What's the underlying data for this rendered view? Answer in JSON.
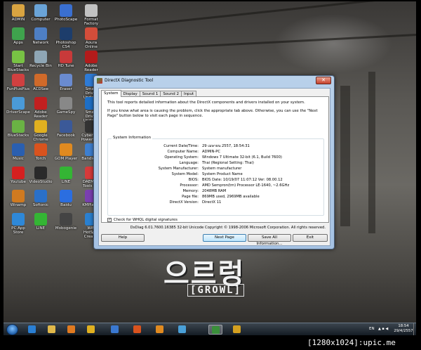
{
  "desktop": {
    "icons": [
      {
        "label": "ADMIN",
        "icon": "user-folder-icon",
        "color": "#d9a441"
      },
      {
        "label": "Computer",
        "icon": "computer-icon",
        "color": "#6aa4d8"
      },
      {
        "label": "PhotoScape",
        "icon": "photoscape-icon",
        "color": "#3a6fd0"
      },
      {
        "label": "Format Factory",
        "icon": "format-factory-icon",
        "color": "#c2c2c2"
      },
      {
        "label": "Apps",
        "icon": "apps-icon",
        "color": "#3fa34d"
      },
      {
        "label": "Network",
        "icon": "network-icon",
        "color": "#4e7fc4"
      },
      {
        "label": "Photoshop CS4",
        "icon": "photoshop-icon",
        "color": "#1d3d6b"
      },
      {
        "label": "Aoura Online",
        "icon": "game-icon",
        "color": "#d34d3a"
      },
      {
        "label": "Start BlueStacks",
        "icon": "bluestacks-icon",
        "color": "#78c244"
      },
      {
        "label": "Recycle Bin",
        "icon": "recycle-bin-icon",
        "color": "#8fa6b5"
      },
      {
        "label": "HD Tune",
        "icon": "hd-tune-icon",
        "color": "#c83a3a"
      },
      {
        "label": "Adobe Reader",
        "icon": "adobe-reader-icon",
        "color": "#b31b1b"
      },
      {
        "label": "FunPlusPlus",
        "icon": "game-icon",
        "color": "#d04040"
      },
      {
        "label": "ACDSee",
        "icon": "acdsee-icon",
        "color": "#d06a2a"
      },
      {
        "label": "Eraser",
        "icon": "app-icon",
        "color": "#6a8bd0"
      },
      {
        "label": "Smart Driver Updater",
        "icon": "driver-icon",
        "color": "#2e7bd6"
      },
      {
        "label": "DriverScape",
        "icon": "driver-icon",
        "color": "#4a9ad8"
      },
      {
        "label": "Adobe Reader",
        "icon": "adobe-reader-icon",
        "color": "#c12020"
      },
      {
        "label": "GameSpy",
        "icon": "game-icon",
        "color": "#888"
      },
      {
        "label": "Smart Driver Updater",
        "icon": "driver-icon",
        "color": "#1e6fc6"
      },
      {
        "label": "BlueStacks",
        "icon": "bluestacks-icon",
        "color": "#6ab344"
      },
      {
        "label": "Google Chrome",
        "icon": "chrome-icon",
        "color": "#e0b020"
      },
      {
        "label": "Facebook",
        "icon": "facebook-icon",
        "color": "#3b5998"
      },
      {
        "label": "CyberLink PowerDVD",
        "icon": "dvd-icon",
        "color": "#333"
      },
      {
        "label": "Music",
        "icon": "music-icon",
        "color": "#2a5fb0"
      },
      {
        "label": "Torch",
        "icon": "torch-icon",
        "color": "#d9531e"
      },
      {
        "label": "GOM Player",
        "icon": "gom-player-icon",
        "color": "#e08a20"
      },
      {
        "label": "Bandicam",
        "icon": "bandicam-icon",
        "color": "#3d7fd0"
      },
      {
        "label": "Youtube",
        "icon": "youtube-icon",
        "color": "#d52020"
      },
      {
        "label": "VideoStudio",
        "icon": "video-icon",
        "color": "#2a2a2a"
      },
      {
        "label": "LINE",
        "icon": "line-icon",
        "color": "#34b534"
      },
      {
        "label": "DAEMON Tools Pro",
        "icon": "daemon-tools-icon",
        "color": "#d63a3a"
      },
      {
        "label": "Winamp",
        "icon": "winamp-icon",
        "color": "#d07a20"
      },
      {
        "label": "Softonic",
        "icon": "softonic-icon",
        "color": "#2a70c8"
      },
      {
        "label": "Baidu",
        "icon": "baidu-icon",
        "color": "#2b6ee0"
      },
      {
        "label": "KMPlayer",
        "icon": "kmplayer-icon",
        "color": "#7a3fb0"
      },
      {
        "label": "PC App Store",
        "icon": "app-store-icon",
        "color": "#2e88d8"
      },
      {
        "label": "LINE",
        "icon": "line-icon",
        "color": "#34b534"
      },
      {
        "label": "Mobogenie",
        "icon": "mobogenie-icon",
        "color": "#444"
      },
      {
        "label": "WiFi HotSpot Creator",
        "icon": "wifi-icon",
        "color": "#2a80d0"
      }
    ],
    "graffiti_main": "으르렁",
    "graffiti_sub": "[GROWL]"
  },
  "dialog": {
    "title": "DirectX Diagnostic Tool",
    "close_glyph": "✕",
    "tabs": [
      {
        "label": "System",
        "active": true
      },
      {
        "label": "Display",
        "active": false
      },
      {
        "label": "Sound 1",
        "active": false
      },
      {
        "label": "Sound 2",
        "active": false
      },
      {
        "label": "Input",
        "active": false
      }
    ],
    "intro": "This tool reports detailed information about the DirectX components and drivers installed on your system.",
    "help_text": "If you know what area is causing the problem, click the appropriate tab above.  Otherwise, you can use the \"Next Page\" button below to visit each page in sequence.",
    "group_label": "System Information",
    "rows": [
      {
        "k": "Current Date/Time:",
        "v": "29 เมษายน 2557, 18:54:31"
      },
      {
        "k": "Computer Name:",
        "v": "ADMIN-PC"
      },
      {
        "k": "Operating System:",
        "v": "Windows 7 Ultimate 32-bit (6.1, Build 7600)"
      },
      {
        "k": "Language:",
        "v": "Thai (Regional Setting: Thai)"
      },
      {
        "k": "System Manufacturer:",
        "v": "System manufacturer"
      },
      {
        "k": "System Model:",
        "v": "System Product Name"
      },
      {
        "k": "BIOS:",
        "v": "BIOS Date: 10/19/07 11:07:12 Ver: 08.00.12"
      },
      {
        "k": "Processor:",
        "v": "AMD Sempron(tm) Processor LE-1640, ~2.6GHz"
      },
      {
        "k": "Memory:",
        "v": "2048MB RAM"
      },
      {
        "k": "Page file:",
        "v": "869MB used, 2969MB available"
      },
      {
        "k": "DirectX Version:",
        "v": "DirectX 11"
      }
    ],
    "whql_label": "Check for WHQL digital signatures",
    "whql_checked": true,
    "whql_check_glyph": "✓",
    "copyright": "DxDiag 6.01.7600.16385 32-bit Unicode  Copyright © 1998-2006 Microsoft Corporation.  All rights reserved.",
    "buttons": {
      "help": "Help",
      "next": "Next Page",
      "save": "Save All Information...",
      "exit": "Exit"
    }
  },
  "taskbar": {
    "pinned": [
      {
        "name": "internet-explorer-icon",
        "color": "#2a7fd4"
      },
      {
        "name": "windows-explorer-icon",
        "color": "#e0b84a"
      },
      {
        "name": "media-player-icon",
        "color": "#e07a20"
      },
      {
        "name": "chrome-icon",
        "color": "#e0b020"
      },
      {
        "name": "star-app-icon",
        "color": "#3a78d0"
      },
      {
        "name": "torch-icon",
        "color": "#d9531e"
      },
      {
        "name": "gom-player-icon",
        "color": "#e08a20"
      },
      {
        "name": "photos-icon",
        "color": "#4aa0d8"
      },
      {
        "name": "directx-icon",
        "color": "#3a8f3a"
      },
      {
        "name": "close-app-icon",
        "color": "#d4a020"
      }
    ],
    "language": "EN",
    "tray": "▲ ▪ ◀",
    "time": "18:54",
    "date": "29/4/2557"
  },
  "watermark": "[1280x1024]:upic.me"
}
